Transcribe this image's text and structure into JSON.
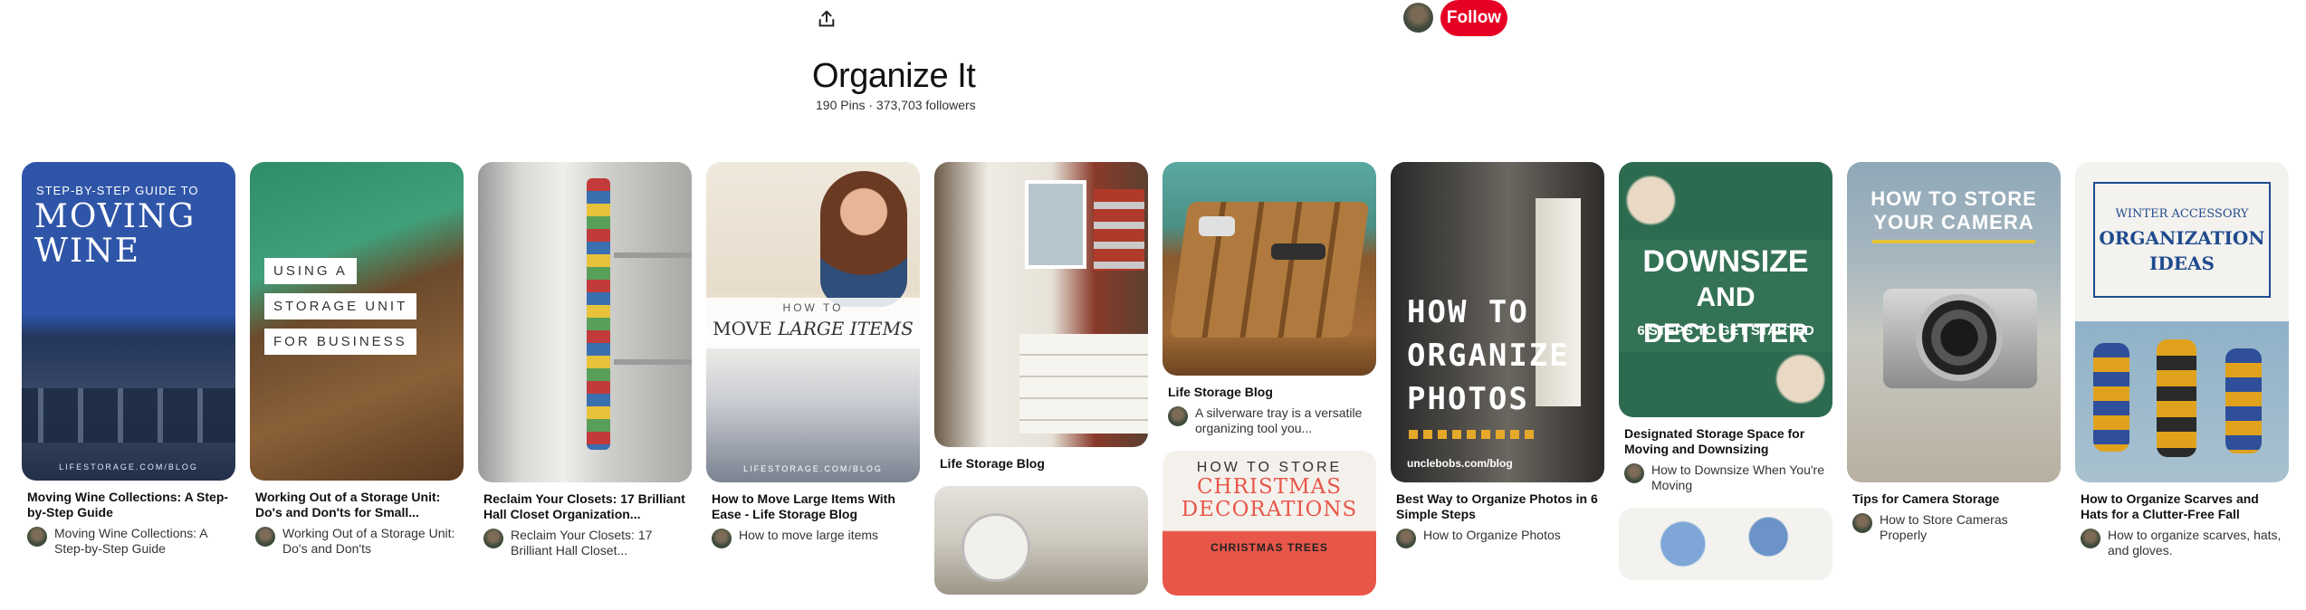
{
  "header": {
    "share_label": "Share",
    "follow_label": "Follow",
    "board_title": "Organize It",
    "board_stats": "190 Pins · 373,703 followers"
  },
  "pins": {
    "p1": {
      "title": "Moving Wine Collections: A Step-by-Step Guide",
      "desc": "Moving Wine Collections: A Step-by-Step Guide",
      "img_kicker": "STEP-BY-STEP GUIDE TO",
      "img_line1": "MOVING",
      "img_line2": "WINE",
      "img_footer": "LIFESTORAGE.COM/BLOG"
    },
    "p2": {
      "title": "Working Out of a Storage Unit: Do's and Don'ts for Small...",
      "desc": "Working Out of a Storage Unit: Do's and Don'ts",
      "img_line1": "USING A",
      "img_line2": "STORAGE UNIT",
      "img_line3": "FOR BUSINESS"
    },
    "p3": {
      "title": "Reclaim Your Closets: 17 Brilliant Hall Closet Organization...",
      "desc": "Reclaim Your Closets: 17 Brilliant Hall Closet..."
    },
    "p4": {
      "title": "How to Move Large Items With Ease - Life Storage Blog",
      "desc": "How to move large items",
      "img_kicker": "HOW TO",
      "img_line1": "MOVE",
      "img_line2": "LARGE ITEMS",
      "img_footer": "LIFESTORAGE.COM/BLOG"
    },
    "p5": {
      "title": "Life Storage Blog"
    },
    "p6": {
      "title": "Life Storage Blog",
      "desc": "A silverware tray is a versatile organizing tool you..."
    },
    "p7": {
      "title": "Best Way to Organize Photos in 6 Simple Steps",
      "desc": "How to Organize Photos",
      "img_line1": "HOW TO",
      "img_line2": "ORGANIZE",
      "img_line3": "PHOTOS",
      "img_footer": "unclebobs.com/blog"
    },
    "p8": {
      "title": "Designated Storage Space for Moving and Downsizing",
      "desc": "How to Downsize When You're Moving",
      "img_line1": "DOWNSIZE",
      "img_line2": "AND DECLUTTER",
      "img_line3": "6 STEPS TO GET STARTED"
    },
    "p9": {
      "title": "Tips for Camera Storage",
      "desc": "How to Store Cameras Properly",
      "img_line1": "HOW TO STORE",
      "img_line2": "YOUR CAMERA"
    },
    "p10": {
      "title": "How to Organize Scarves and Hats for a Clutter-Free Fall",
      "desc": "How to organize scarves, hats, and gloves.",
      "img_line1": "WINTER ACCESSORY",
      "img_line2": "ORGANIZATION",
      "img_line3": "IDEAS"
    },
    "p11": {
      "img_line1": "HOW TO STORE",
      "img_line2": "CHRISTMAS",
      "img_line3": "DECORATIONS",
      "img_line4": "CHRISTMAS TREES"
    }
  }
}
